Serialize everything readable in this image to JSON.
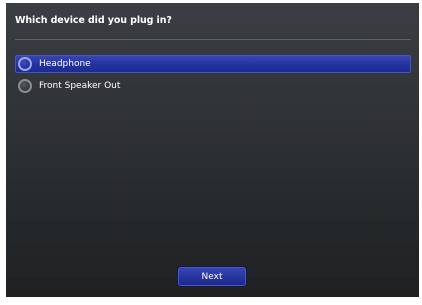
{
  "dialog": {
    "question": "Which device did you plug in?",
    "options": [
      {
        "label": "Headphone",
        "selected": true
      },
      {
        "label": "Front Speaker Out",
        "selected": false
      }
    ],
    "next_label": "Next"
  },
  "colors": {
    "background_top": "#3b3e42",
    "background_bottom": "#1f2123",
    "selection": "#2434a0",
    "button": "#26339c",
    "text": "#ffffff"
  }
}
